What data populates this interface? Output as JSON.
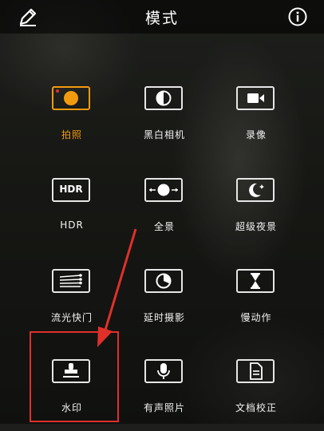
{
  "header": {
    "title": "模式",
    "edit_icon": "pencil-icon",
    "info_icon": "info-icon"
  },
  "modes": [
    {
      "label": "拍照",
      "icon": "photo-shutter-icon",
      "active": true
    },
    {
      "label": "黑白相机",
      "icon": "black-white-icon",
      "active": false
    },
    {
      "label": "录像",
      "icon": "video-camera-icon",
      "active": false
    },
    {
      "label": "HDR",
      "icon": "hdr-icon",
      "active": false
    },
    {
      "label": "全景",
      "icon": "panorama-icon",
      "active": false
    },
    {
      "label": "超级夜景",
      "icon": "night-moon-icon",
      "active": false
    },
    {
      "label": "流光快门",
      "icon": "light-trail-icon",
      "active": false
    },
    {
      "label": "延时摄影",
      "icon": "timelapse-icon",
      "active": false
    },
    {
      "label": "慢动作",
      "icon": "hourglass-icon",
      "active": false
    },
    {
      "label": "水印",
      "icon": "stamp-icon",
      "active": false
    },
    {
      "label": "有声照片",
      "icon": "microphone-icon",
      "active": false
    },
    {
      "label": "文档校正",
      "icon": "document-icon",
      "active": false
    }
  ],
  "colors": {
    "accent": "#f29a0e",
    "annotation": "#e0302a",
    "text": "#f2f2f2"
  }
}
